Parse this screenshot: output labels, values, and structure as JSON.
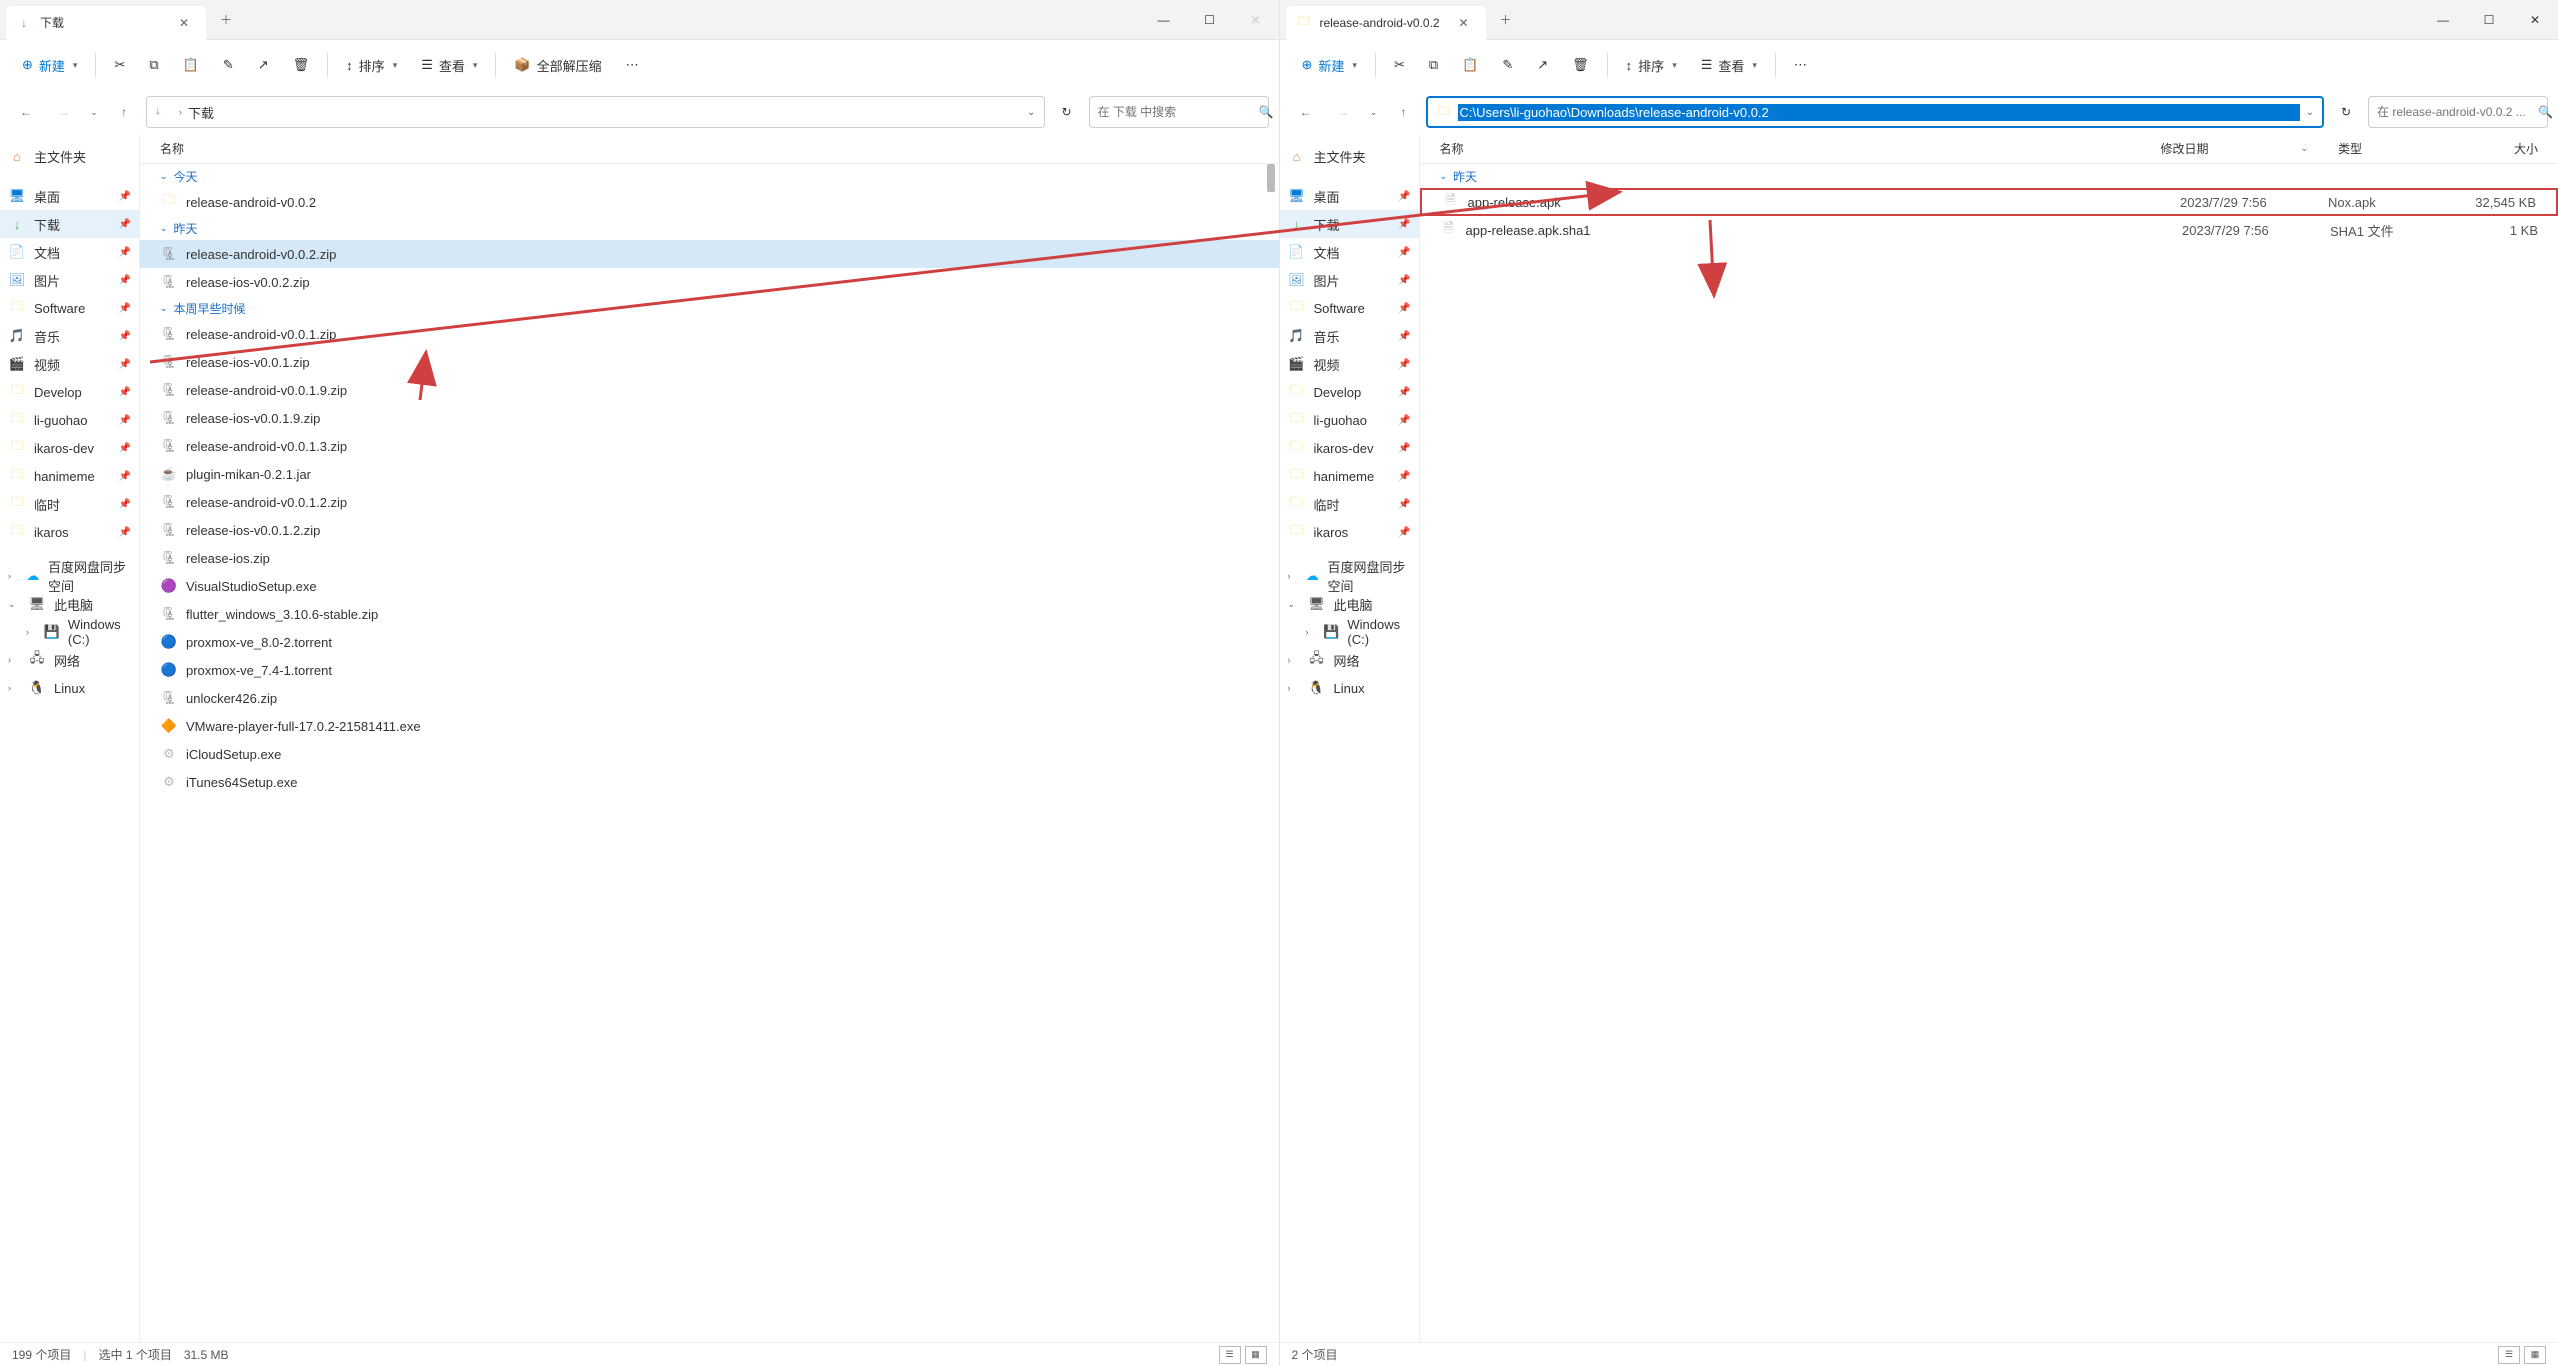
{
  "left": {
    "tab_title": "下载",
    "toolbar": {
      "new": "新建",
      "sort": "排序",
      "view": "查看",
      "extract": "全部解压缩"
    },
    "breadcrumb": "下载",
    "search_placeholder": "在 下载 中搜索",
    "sidebar": {
      "home": "主文件夹",
      "items": [
        {
          "label": "桌面",
          "icon": "desktop"
        },
        {
          "label": "下载",
          "icon": "download",
          "active": true
        },
        {
          "label": "文档",
          "icon": "doc"
        },
        {
          "label": "图片",
          "icon": "pic"
        },
        {
          "label": "Software",
          "icon": "folder"
        },
        {
          "label": "音乐",
          "icon": "music"
        },
        {
          "label": "视频",
          "icon": "video"
        },
        {
          "label": "Develop",
          "icon": "folder"
        },
        {
          "label": "li-guohao",
          "icon": "folder"
        },
        {
          "label": "ikaros-dev",
          "icon": "folder"
        },
        {
          "label": "hanimeme",
          "icon": "folder"
        },
        {
          "label": "临时",
          "icon": "folder"
        },
        {
          "label": "ikaros",
          "icon": "folder"
        }
      ],
      "sections": [
        {
          "label": "百度网盘同步空间",
          "icon": "cloud",
          "expand": ">"
        },
        {
          "label": "此电脑",
          "icon": "pc",
          "expand": "v"
        },
        {
          "label": "Windows (C:)",
          "icon": "drive",
          "indent": true,
          "expand": ">"
        },
        {
          "label": "网络",
          "icon": "net",
          "expand": ">"
        },
        {
          "label": "Linux",
          "icon": "linux",
          "expand": ">"
        }
      ]
    },
    "columns": {
      "name": "名称"
    },
    "groups": [
      {
        "name": "今天",
        "files": [
          {
            "name": "release-android-v0.0.2",
            "icon": "folder"
          }
        ]
      },
      {
        "name": "昨天",
        "files": [
          {
            "name": "release-android-v0.0.2.zip",
            "icon": "zip",
            "selected": true
          },
          {
            "name": "release-ios-v0.0.2.zip",
            "icon": "zip"
          }
        ]
      },
      {
        "name": "本周早些时候",
        "files": [
          {
            "name": "release-android-v0.0.1.zip",
            "icon": "zip"
          },
          {
            "name": "release-ios-v0.0.1.zip",
            "icon": "zip"
          },
          {
            "name": "release-android-v0.0.1.9.zip",
            "icon": "zip"
          },
          {
            "name": "release-ios-v0.0.1.9.zip",
            "icon": "zip"
          },
          {
            "name": "release-android-v0.0.1.3.zip",
            "icon": "zip"
          },
          {
            "name": "plugin-mikan-0.2.1.jar",
            "icon": "jar"
          },
          {
            "name": "release-android-v0.0.1.2.zip",
            "icon": "zip"
          },
          {
            "name": "release-ios-v0.0.1.2.zip",
            "icon": "zip"
          },
          {
            "name": "release-ios.zip",
            "icon": "zip"
          },
          {
            "name": "VisualStudioSetup.exe",
            "icon": "exe-vs"
          },
          {
            "name": "flutter_windows_3.10.6-stable.zip",
            "icon": "zip"
          },
          {
            "name": "proxmox-ve_8.0-2.torrent",
            "icon": "torrent"
          },
          {
            "name": "proxmox-ve_7.4-1.torrent",
            "icon": "torrent"
          },
          {
            "name": "unlocker426.zip",
            "icon": "zip"
          },
          {
            "name": "VMware-player-full-17.0.2-21581411.exe",
            "icon": "exe-vm"
          },
          {
            "name": "iCloudSetup.exe",
            "icon": "exe"
          },
          {
            "name": "iTunes64Setup.exe",
            "icon": "exe"
          }
        ]
      }
    ],
    "status": {
      "count": "199 个项目",
      "selected": "选中 1 个项目",
      "size": "31.5 MB"
    }
  },
  "right": {
    "tab_title": "release-android-v0.0.2",
    "toolbar": {
      "new": "新建",
      "sort": "排序",
      "view": "查看"
    },
    "address_path": "C:\\Users\\li-guohao\\Downloads\\release-android-v0.0.2",
    "search_placeholder": "在 release-android-v0.0.2 ...",
    "sidebar": {
      "home": "主文件夹",
      "items": [
        {
          "label": "桌面",
          "icon": "desktop"
        },
        {
          "label": "下载",
          "icon": "download",
          "active": true
        },
        {
          "label": "文档",
          "icon": "doc"
        },
        {
          "label": "图片",
          "icon": "pic"
        },
        {
          "label": "Software",
          "icon": "folder"
        },
        {
          "label": "音乐",
          "icon": "music"
        },
        {
          "label": "视频",
          "icon": "video"
        },
        {
          "label": "Develop",
          "icon": "folder"
        },
        {
          "label": "li-guohao",
          "icon": "folder"
        },
        {
          "label": "ikaros-dev",
          "icon": "folder"
        },
        {
          "label": "hanimeme",
          "icon": "folder"
        },
        {
          "label": "临时",
          "icon": "folder"
        },
        {
          "label": "ikaros",
          "icon": "folder"
        }
      ],
      "sections": [
        {
          "label": "百度网盘同步空间",
          "icon": "cloud",
          "expand": ">"
        },
        {
          "label": "此电脑",
          "icon": "pc",
          "expand": "v"
        },
        {
          "label": "Windows (C:)",
          "icon": "drive",
          "indent": true,
          "expand": ">"
        },
        {
          "label": "网络",
          "icon": "net",
          "expand": ">"
        },
        {
          "label": "Linux",
          "icon": "linux",
          "expand": ">"
        }
      ]
    },
    "columns": {
      "name": "名称",
      "date": "修改日期",
      "type": "类型",
      "size": "大小"
    },
    "groups": [
      {
        "name": "昨天",
        "files": [
          {
            "name": "app-release.apk",
            "date": "2023/7/29 7:56",
            "type": "Nox.apk",
            "size": "32,545 KB",
            "highlighted": true
          },
          {
            "name": "app-release.apk.sha1",
            "date": "2023/7/29 7:56",
            "type": "SHA1 文件",
            "size": "1 KB"
          }
        ]
      }
    ],
    "status": {
      "count": "2 个项目"
    }
  }
}
